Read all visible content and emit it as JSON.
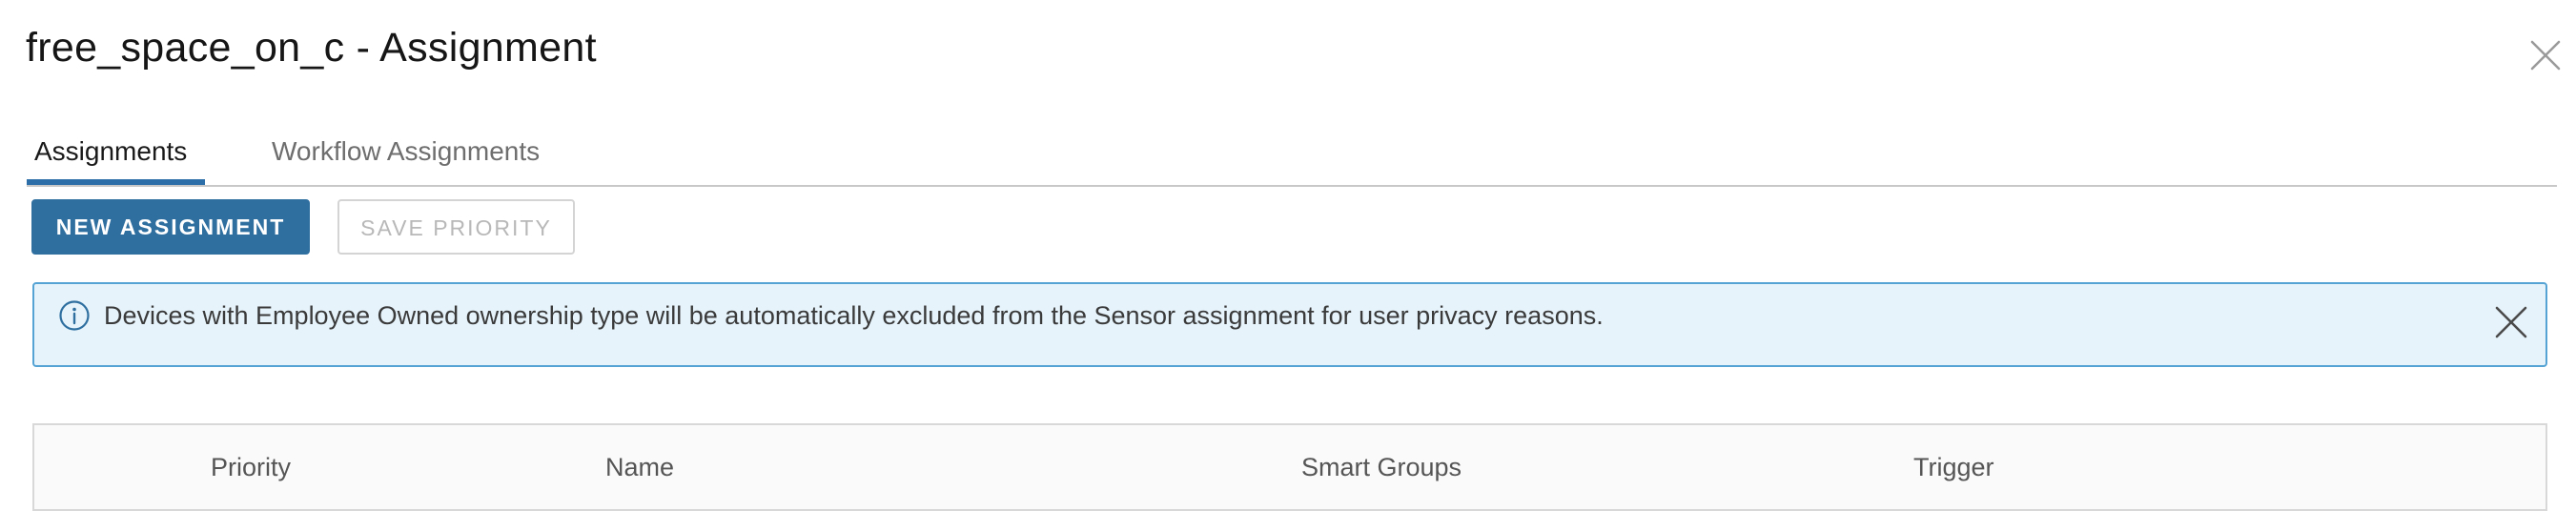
{
  "modal": {
    "title": "free_space_on_c - Assignment",
    "close_icon": "close-icon"
  },
  "tabs": [
    {
      "label": "Assignments",
      "active": true
    },
    {
      "label": "Workflow Assignments",
      "active": false
    }
  ],
  "toolbar": {
    "new_assignment_label": "NEW ASSIGNMENT",
    "save_priority_label": "SAVE PRIORITY",
    "save_priority_disabled": true
  },
  "alert": {
    "icon": "info-icon",
    "message": "Devices with Employee Owned ownership type will be automatically excluded from the Sensor assignment for user privacy reasons.",
    "dismiss_icon": "close-icon"
  },
  "table": {
    "columns": [
      "Priority",
      "Name",
      "Smart Groups",
      "Trigger"
    ],
    "rows": []
  },
  "colors": {
    "primary_button": "#2e6fa0",
    "active_tab_underline": "#2c6ea8",
    "alert_background": "#e6f3fb",
    "alert_border": "#55a3d4"
  }
}
